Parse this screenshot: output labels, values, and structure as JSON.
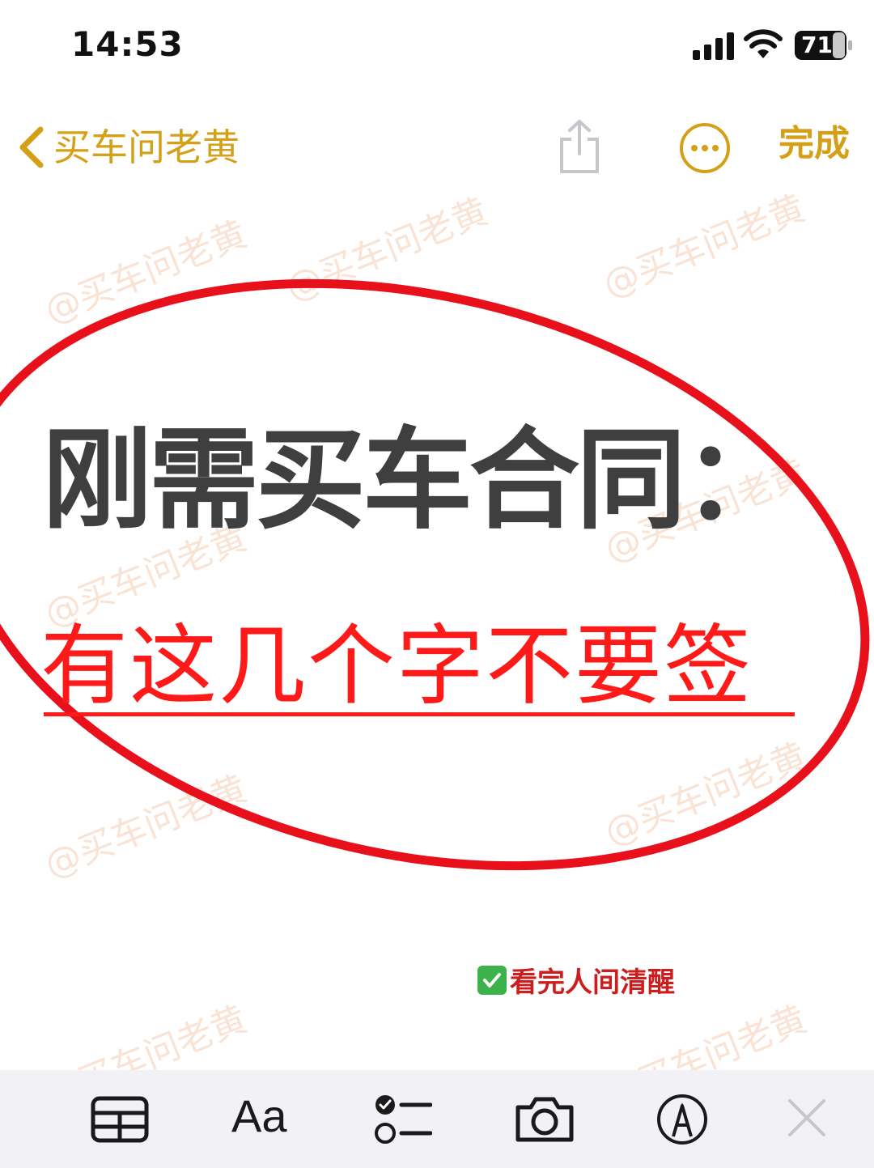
{
  "status_bar": {
    "time": "14:53",
    "battery": "71"
  },
  "nav": {
    "back_label": "买车问老黄",
    "done_label": "完成"
  },
  "watermark_text": "@买车问老黄",
  "note": {
    "headline": "刚需买车合同：",
    "subline": "有这几个字不要签",
    "tip": "看完人间清醒"
  },
  "colors": {
    "accent": "#d4a017",
    "headline": "#3f3f3f",
    "highlight_red": "#ff1a1a",
    "ellipse_red": "#e8101a",
    "toolbar_bg": "#f2f2f6"
  },
  "icons": {
    "toolbar": [
      "table-icon",
      "format-text-icon",
      "checklist-icon",
      "camera-icon",
      "markup-icon",
      "close-icon"
    ],
    "toolbar_text_label": "Aa"
  }
}
